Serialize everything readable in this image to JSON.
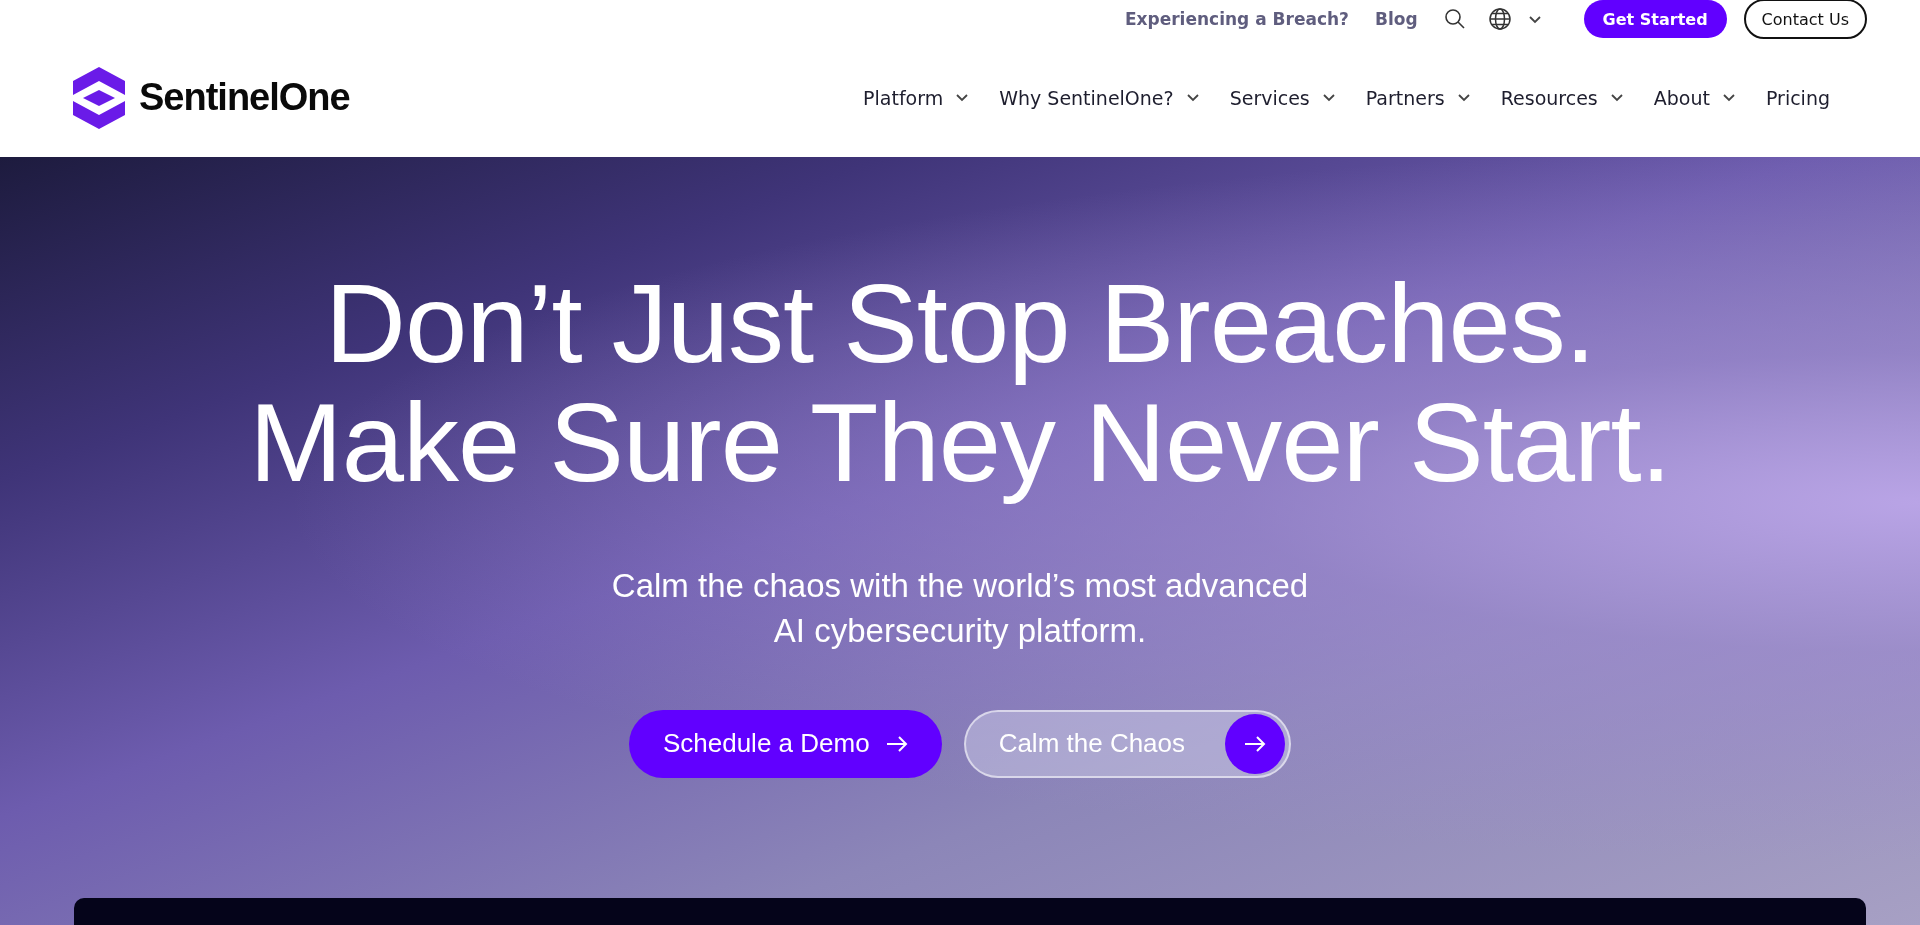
{
  "utility_bar": {
    "links": [
      "Experiencing a Breach?",
      "Blog"
    ],
    "primary_button": "Get Started",
    "secondary_button": "Contact Us"
  },
  "logo": {
    "text": "SentinelOne"
  },
  "nav": [
    {
      "label": "Platform",
      "dropdown": true
    },
    {
      "label": "Why SentinelOne?",
      "dropdown": true
    },
    {
      "label": "Services",
      "dropdown": true
    },
    {
      "label": "Partners",
      "dropdown": true
    },
    {
      "label": "Resources",
      "dropdown": true
    },
    {
      "label": "About",
      "dropdown": true
    },
    {
      "label": "Pricing",
      "dropdown": false
    }
  ],
  "hero": {
    "headline": [
      "Don’t Just Stop Breaches.",
      "Make Sure They Never Start."
    ],
    "subtitle": [
      "Calm the chaos with the world’s most advanced",
      "AI cybersecurity platform."
    ],
    "buttons": [
      {
        "label": "Schedule a Demo",
        "kind": "primary"
      },
      {
        "label": "Calm the Chaos",
        "kind": "glass"
      }
    ]
  }
}
